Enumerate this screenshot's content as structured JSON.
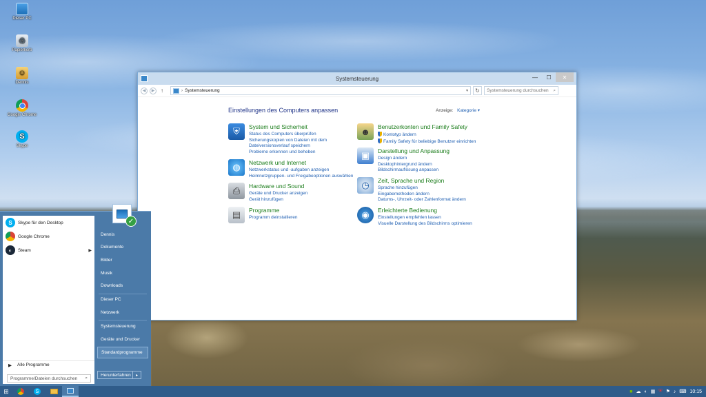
{
  "desktop": {
    "icons": [
      {
        "label": "Dieser PC",
        "icon": "computer-icon"
      },
      {
        "label": "Papierkorb",
        "icon": "recycle-bin-icon"
      },
      {
        "label": "Dennis",
        "icon": "user-folder-icon"
      },
      {
        "label": "Google Chrome",
        "icon": "chrome-icon"
      },
      {
        "label": "Skype",
        "icon": "skype-icon"
      }
    ]
  },
  "window": {
    "title": "Systemsteuerung",
    "controls": {
      "minimize": "—",
      "maximize": "☐",
      "close": "✕"
    },
    "address": {
      "path": "Systemsteuerung",
      "search_placeholder": "Systemsteuerung durchsuchen"
    },
    "heading": "Einstellungen des Computers anpassen",
    "view_by_label": "Anzeige:",
    "view_by_value": "Kategorie",
    "categories_left": [
      {
        "title": "System und Sicherheit",
        "links": [
          "Status des Computers überprüfen",
          "Sicherungskopien von Dateien mit dem Dateiversionsverlauf speichern",
          "Probleme erkennen und beheben"
        ]
      },
      {
        "title": "Netzwerk und Internet",
        "links": [
          "Netzwerkstatus und -aufgaben anzeigen",
          "Heimnetzgruppen- und Freigabeoptionen auswählen"
        ]
      },
      {
        "title": "Hardware und Sound",
        "links": [
          "Geräte und Drucker anzeigen",
          "Gerät hinzufügen"
        ]
      },
      {
        "title": "Programme",
        "links": [
          "Programm deinstallieren"
        ]
      }
    ],
    "categories_right": [
      {
        "title": "Benutzerkonten und Family Safety",
        "links": [
          "Kontotyp ändern",
          "Family Safety für beliebige Benutzer einrichten"
        ]
      },
      {
        "title": "Darstellung und Anpassung",
        "links": [
          "Design ändern",
          "Desktophintergrund ändern",
          "Bildschirmauflösung anpassen"
        ]
      },
      {
        "title": "Zeit, Sprache und Region",
        "links": [
          "Sprache hinzufügen",
          "Eingabemethoden ändern",
          "Datums-, Uhrzeit- oder Zahlenformat ändern"
        ]
      },
      {
        "title": "Erleichterte Bedienung",
        "links": [
          "Einstellungen empfehlen lassen",
          "Visuelle Darstellung des Bildschirms optimieren"
        ]
      }
    ]
  },
  "startmenu": {
    "pinned": [
      {
        "label": "Skype für den Desktop",
        "icon": "skype-icon"
      },
      {
        "label": "Google Chrome",
        "icon": "chrome-icon"
      },
      {
        "label": "Steam",
        "icon": "steam-icon"
      }
    ],
    "all_programs": "Alle Programme",
    "search_placeholder": "Programme/Dateien durchsuchen",
    "right_items": [
      "Dennis",
      "Dokumente",
      "Bilder",
      "Musik",
      "Downloads",
      "Dieser PC",
      "Netzwerk",
      "Systemsteuerung",
      "Geräte und Drucker",
      "Standardprogramme"
    ],
    "shutdown_label": "Herunterfahren"
  },
  "taskbar": {
    "clock": "10:15",
    "accent": "#2f5c8a"
  }
}
